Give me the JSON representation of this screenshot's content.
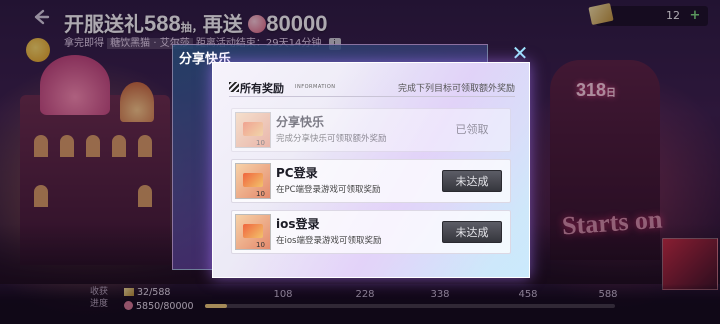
{
  "header": {
    "title_prefix": "开服送礼",
    "title_number": "588",
    "title_unit": "抽，",
    "title_mid": "再送",
    "title_coins": "80000",
    "subtitle_a": "拿完即得",
    "subtitle_highlight": "糖饮黑猫 · 艾尔莎",
    "subtitle_b": "距离活动结束：29天14分钟",
    "info_icon_label": "i"
  },
  "currency": {
    "ticket_count": "12",
    "plus_label": "+"
  },
  "scene_text": {
    "bubble_number": "318",
    "bubble_suffix": "日",
    "starts_on": "Starts on"
  },
  "modal": {
    "back_title": "分享快乐",
    "close_label": "✕",
    "section_title": "所有奖励",
    "section_sub": "INFORMATION",
    "section_hint": "完成下列目标可领取额外奖励",
    "tasks": [
      {
        "title": "分享快乐",
        "desc": "完成分享快乐可领取额外奖励",
        "qty": "10",
        "status": "已领取"
      },
      {
        "title": "PC登录",
        "desc": "在PC端登录游戏可领取奖励",
        "qty": "10",
        "status": "未达成"
      },
      {
        "title": "ios登录",
        "desc": "在ios端登录游戏可领取奖励",
        "qty": "10",
        "status": "未达成"
      }
    ]
  },
  "progress": {
    "label": "收获进度",
    "tickets": "32/588",
    "coins": "5850/80000",
    "fraction": 0.054,
    "milestones": [
      "108",
      "228",
      "338",
      "458",
      "588"
    ]
  }
}
